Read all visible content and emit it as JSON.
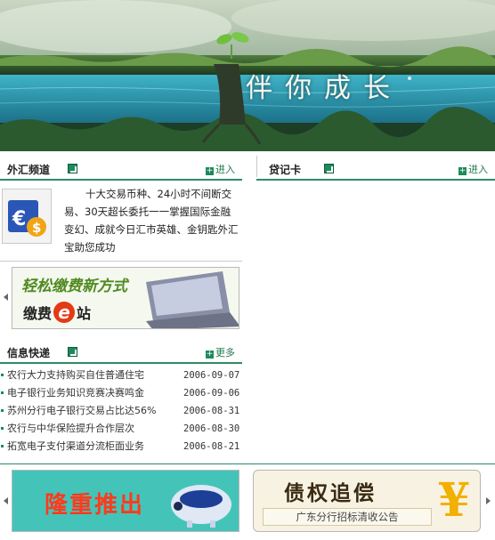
{
  "banner": {
    "slogan": "伴你成长"
  },
  "fx": {
    "title": "外汇频道",
    "more_label": "进入",
    "description": "十大交易币种、24小时不间断交易、30天超长委托一一掌握国际金融变幻、成就今日汇市英雄、金钥匙外汇宝助您成功"
  },
  "loan": {
    "title": "贷记卡",
    "more_label": "进入"
  },
  "ad_epay": {
    "line1": "轻松缴费新方式",
    "line2_pre": "缴费",
    "line2_e": "e",
    "line2_post": "站"
  },
  "news": {
    "title": "信息快递",
    "more_label": "更多",
    "items": [
      {
        "title": "农行大力支持购买自住普通住宅",
        "date": "2006-09-07"
      },
      {
        "title": "电子银行业务知识竞赛决赛鸣金",
        "date": "2006-09-06"
      },
      {
        "title": "苏州分行电子银行交易占比达56%",
        "date": "2006-08-31"
      },
      {
        "title": "农行与中华保险提升合作层次",
        "date": "2006-08-30"
      },
      {
        "title": "拓宽电子支付渠道分流柜面业务",
        "date": "2006-08-21"
      }
    ]
  },
  "ad_launch": {
    "text": "隆重推出"
  },
  "ad_debt": {
    "title": "债权追偿",
    "subtitle": "广东分行招标清收公告",
    "yen": "¥"
  },
  "colors": {
    "accent": "#2f8a66",
    "link": "#1e7a4c"
  }
}
